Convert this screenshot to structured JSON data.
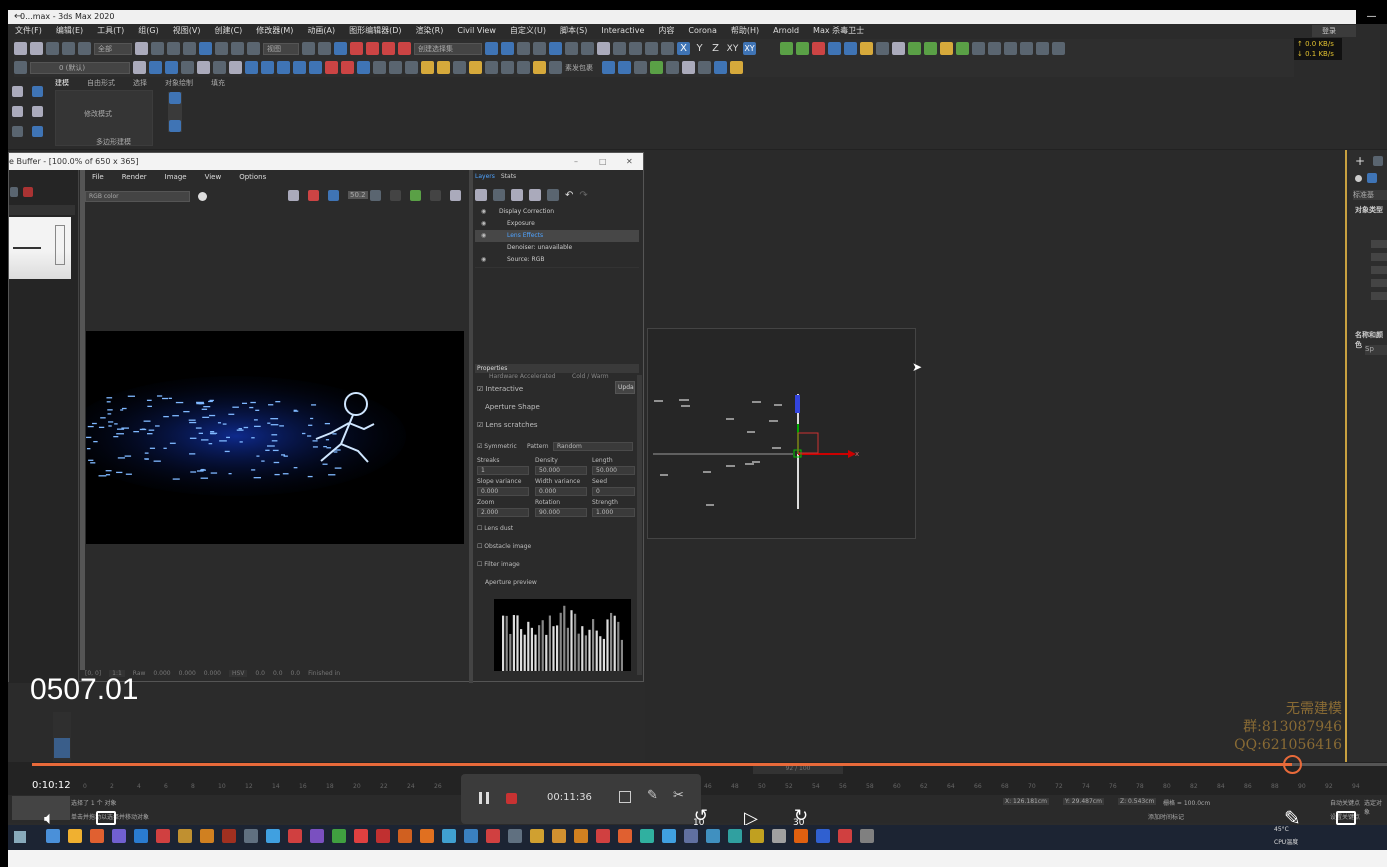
{
  "window": {
    "title": "3ds Max 2020",
    "tab_label": "0...max"
  },
  "menus": [
    "文件(F)",
    "编辑(E)",
    "工具(T)",
    "组(G)",
    "视图(V)",
    "创建(C)",
    "修改器(M)",
    "动画(A)",
    "图形编辑器(D)",
    "渲染(R)",
    "Civil View",
    "自定义(U)",
    "脚本(S)",
    "Interactive",
    "内容",
    "Corona",
    "帮助(H)",
    "Arnold",
    "Max 杀毒卫士"
  ],
  "toolbar": {
    "filter_value": "全部",
    "view_value": "视图",
    "selection_set": "创建选择集",
    "layer_value": "0 (默认)",
    "status_up": "↑ 0.0 KB/s",
    "status_down": "↓ 0.1 KB/s",
    "xyz": [
      "X",
      "Y",
      "Z",
      "XY",
      "XY"
    ],
    "net_label": "素发包裹",
    "login": "登录"
  },
  "ribbon": {
    "tabs": [
      "建模",
      "自由形式",
      "选择",
      "对象绘制",
      "填充"
    ],
    "modify_mode": "修改模式",
    "poly_model": "多边形建模"
  },
  "frame_buffer": {
    "title": "e Buffer - [100.0% of 650 x 365]",
    "menu": [
      "File",
      "Render",
      "Image",
      "View",
      "Options"
    ],
    "channel": "RGB color",
    "percent": "50.2",
    "panel_tabs": [
      "Layers",
      "Stats"
    ],
    "layers": [
      {
        "name": "Display Correction",
        "highlight": false
      },
      {
        "name": "Exposure",
        "highlight": false
      },
      {
        "name": "Lens Effects",
        "highlight": true
      },
      {
        "name": "Denoiser: unavailable",
        "highlight": false
      },
      {
        "name": "Source: RGB",
        "highlight": false
      }
    ],
    "properties_label": "Properties",
    "props": {
      "hardware": "Hardware Accelerated",
      "cold_warm": "Cold / Warm",
      "interactive": "Interactive",
      "update": "Upda",
      "aperture_shape": "Aperture Shape",
      "lens_scratches": "Lens scratches",
      "symmetric": "Symmetric",
      "pattern_label": "Pattern",
      "pattern_value": "Random",
      "streaks_label": "Streaks",
      "density_label": "Density",
      "length_label": "Length",
      "streaks": "1",
      "density": "50.000",
      "length": "50.000",
      "slope_label": "Slope variance",
      "width_label": "Width variance",
      "seed_label": "Seed",
      "slope": "0.000",
      "width": "0.000",
      "seed": "0",
      "zoom_label": "Zoom",
      "rotation_label": "Rotation",
      "strength_label": "Strength",
      "zoom": "2.000",
      "rotation": "90.000",
      "strength": "1.000",
      "lens_dust": "Lens dust",
      "obstacle": "Obstacle image",
      "filter": "Filter image",
      "aperture_preview": "Aperture preview"
    },
    "status": {
      "coords": "[0, 0]",
      "ratio": "1:1",
      "raw": "Raw",
      "v1": "0.000",
      "v2": "0.000",
      "v3": "0.000",
      "mode": "HSV",
      "v4": "0.0",
      "v5": "0.0",
      "v6": "0.0",
      "finished": "Finished in"
    }
  },
  "right_panel": {
    "label1": "对象类型",
    "label2": "名称和颜色",
    "list": "标准基",
    "sp": "Sp"
  },
  "watermark": {
    "line1": "无需建模",
    "line2": "群:813087946",
    "line3": "QQ:621056416"
  },
  "video": {
    "clip_label": "0507.01",
    "current_time": "0:10:12",
    "recording_time": "00:11:36",
    "progress": 0.93,
    "skip_back": "10",
    "skip_forward": "30"
  },
  "timeline": {
    "frame": "92 / 100",
    "ticks": [
      "0",
      "2",
      "4",
      "6",
      "8",
      "10",
      "12",
      "14",
      "16",
      "18",
      "20",
      "22",
      "24",
      "26",
      "28",
      "30",
      "32",
      "34",
      "36",
      "38",
      "40",
      "42",
      "44",
      "46",
      "48",
      "50",
      "52",
      "54",
      "56",
      "58",
      "60",
      "62",
      "64",
      "66",
      "68",
      "70",
      "72",
      "74",
      "76",
      "78",
      "80",
      "82",
      "84",
      "86",
      "88",
      "90",
      "92",
      "94"
    ]
  },
  "statusbar": {
    "selected": "选择了 1 个 对象",
    "hint": "单击并拖动以选择并移动对象",
    "x": "X: 126.181cm",
    "y": "Y: 29.487cm",
    "z": "Z: 0.543cm",
    "grid": "栅格 = 100.0cm",
    "add_time": "添加时间标记",
    "auto_key": "自动关键点",
    "select_obj": "选定对象",
    "set_key": "设置关键点",
    "cpu": "CPU温度",
    "temp": "45°C"
  }
}
